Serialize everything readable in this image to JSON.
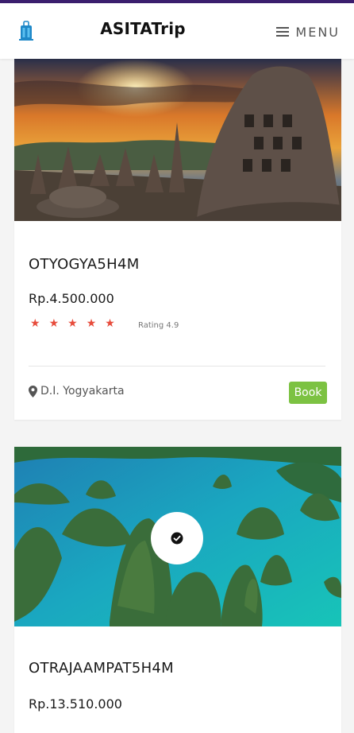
{
  "header": {
    "brand": "ASITATrip",
    "menu_label": "MENU",
    "accent_color": "#3b1e6e"
  },
  "tours": [
    {
      "title": "OTYOGYA5H4M",
      "price": "Rp.4.500.000",
      "rating_label": "Rating 4.9",
      "stars": 5,
      "location": "D.I. Yogyakarta",
      "book_label": "Book",
      "photo": "borobudur-temple-sunset"
    },
    {
      "title": "OTRAJAAMPAT5H4M",
      "price": "Rp.13.510.000",
      "photo": "raja-ampat-islands",
      "selected_icon": "check-icon"
    }
  ],
  "colors": {
    "star": "#e74c3c",
    "book_button": "#7cc242"
  }
}
